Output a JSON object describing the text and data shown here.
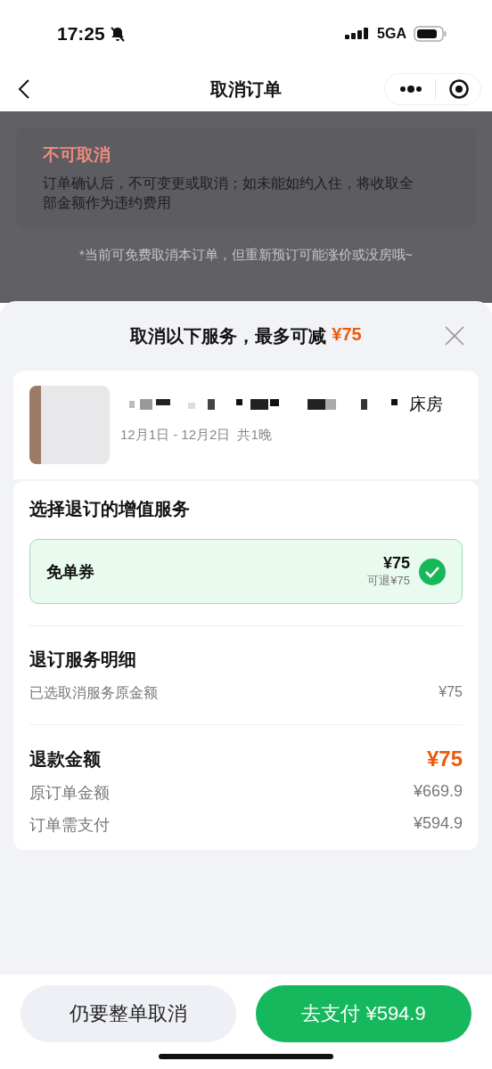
{
  "status_bar": {
    "time": "17:25",
    "network": "5GA"
  },
  "nav": {
    "title": "取消订单"
  },
  "background_notice": {
    "title": "不可取消",
    "text": "订单确认后，不可变更或取消；如未能如约入住，将收取全部金额作为违约费用",
    "note": "*当前可免费取消本订单，但重新预订可能涨价或没房哦~"
  },
  "sheet": {
    "title": "取消以下服务，最多可减",
    "max_reduction": "¥75"
  },
  "hotel": {
    "room_name": "床房",
    "dates": "12月1日 - 12月2日",
    "nights": "共1晚"
  },
  "services": {
    "heading": "选择退订的增值服务",
    "items": [
      {
        "name": "免单券",
        "price": "¥75",
        "refundable": "可退¥75",
        "selected": true
      }
    ]
  },
  "details": {
    "heading": "退订服务明细",
    "rows": [
      {
        "label": "已选取消服务原金额",
        "value": "¥75"
      }
    ]
  },
  "refund": {
    "label": "退款金额",
    "amount": "¥75",
    "rows": [
      {
        "label": "原订单金额",
        "value": "¥669.9"
      },
      {
        "label": "订单需支付",
        "value": "¥594.9"
      }
    ]
  },
  "actions": [
    {
      "label": "仍要整单取消",
      "kind": "secondary"
    },
    {
      "label": "去支付 ¥594.9",
      "kind": "primary"
    }
  ]
}
